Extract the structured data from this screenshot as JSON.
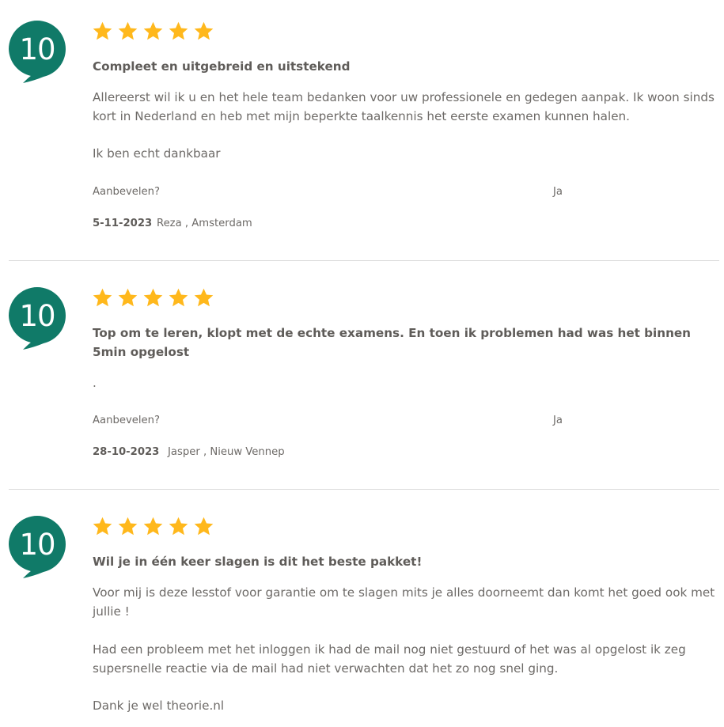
{
  "colors": {
    "badge": "#107a68",
    "star": "#ffb81c",
    "text": "#6d6a67",
    "divider": "#d9d9d9"
  },
  "recommend_label": "Aanbevelen?",
  "reviews": [
    {
      "score": "10",
      "rating_stars": 5,
      "title": "Compleet en uitgebreid en uitstekend",
      "paragraphs": [
        "Allereerst wil ik u en het hele team bedanken voor uw professionele en gedegen aanpak. Ik woon sinds kort in Nederland en heb met mijn beperkte taalkennis het eerste examen kunnen halen.",
        "Ik ben echt dankbaar"
      ],
      "recommend": "Ja",
      "date": "5-11-2023",
      "author": "Reza , Amsterdam"
    },
    {
      "score": "10",
      "rating_stars": 5,
      "title": "Top om te leren, klopt met de echte examens. En toen ik problemen had was het binnen 5min opgelost",
      "paragraphs": [
        "."
      ],
      "recommend": "Ja",
      "date": "28-10-2023",
      "author": "Jasper , Nieuw Vennep"
    },
    {
      "score": "10",
      "rating_stars": 5,
      "title": "Wil je in één keer slagen is dit het beste pakket!",
      "paragraphs": [
        "Voor mij is deze lesstof voor garantie om te slagen mits je alles doorneemt dan komt het goed ook met jullie !",
        "Had een probleem met het inloggen ik had de mail nog niet gestuurd of het was al opgelost ik zeg supersnelle reactie via de mail had niet verwachten dat het zo nog snel ging.",
        "Dank je wel theorie.nl"
      ]
    }
  ]
}
